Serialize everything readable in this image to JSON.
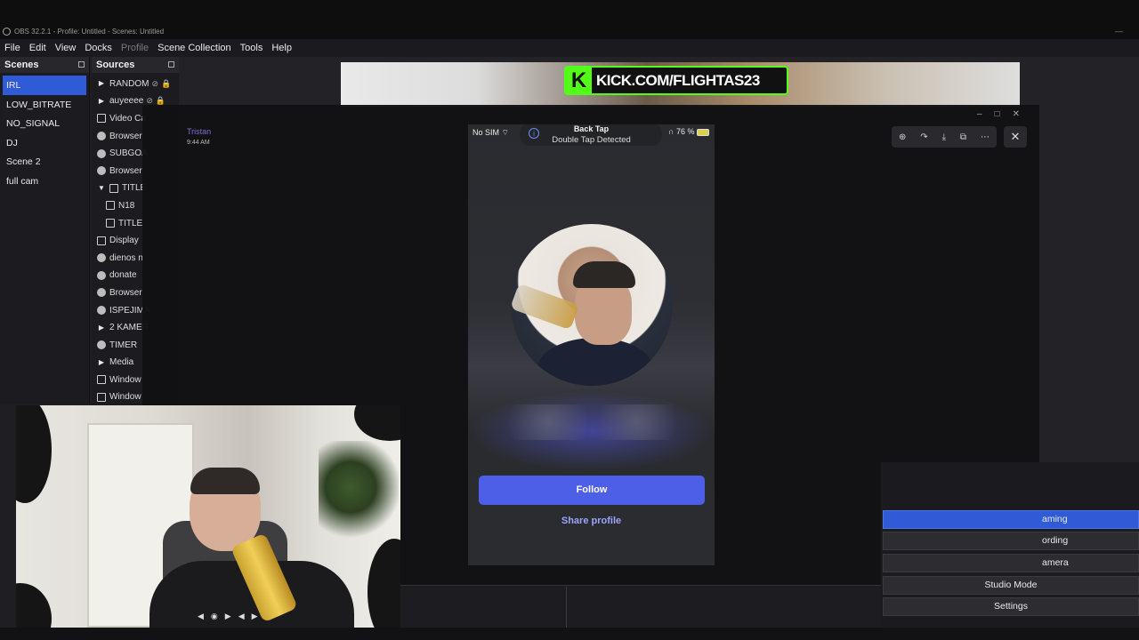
{
  "window": {
    "title": "OBS 32.2.1 - Profile: Untitled - Scenes: Untitled",
    "minimize": "—"
  },
  "menu": [
    "File",
    "Edit",
    "View",
    "Docks",
    "Profile",
    "Scene Collection",
    "Tools",
    "Help"
  ],
  "scenes": {
    "header": "Scenes",
    "items": [
      "IRL",
      "LOW_BITRATE",
      "NO_SIGNAL",
      "DJ",
      "Scene 2",
      "full cam"
    ],
    "active": "IRL"
  },
  "sources": {
    "header": "Sources",
    "items": [
      {
        "label": "RANDOM",
        "icon": "play-icon"
      },
      {
        "label": "auyeeee",
        "icon": "play-icon"
      },
      {
        "label": "Video Ca",
        "icon": "video-capture-icon"
      },
      {
        "label": "Browser",
        "icon": "browser-icon"
      },
      {
        "label": "SUBGOA",
        "icon": "browser-icon"
      },
      {
        "label": "Browser",
        "icon": "browser-icon"
      },
      {
        "label": "TITLE",
        "icon": "folder-icon"
      },
      {
        "label": "N18",
        "icon": "image-icon"
      },
      {
        "label": "TITLE",
        "icon": "image-icon"
      },
      {
        "label": "Display",
        "icon": "display-icon"
      },
      {
        "label": "dienos n",
        "icon": "browser-icon"
      },
      {
        "label": "donate",
        "icon": "browser-icon"
      },
      {
        "label": "Browser",
        "icon": "browser-icon"
      },
      {
        "label": "ISPEJIMA",
        "icon": "browser-icon"
      },
      {
        "label": "2 KAMER",
        "icon": "play-icon"
      },
      {
        "label": "TIMER",
        "icon": "browser-icon"
      },
      {
        "label": "Media",
        "icon": "play-icon"
      },
      {
        "label": "Window",
        "icon": "window-icon"
      },
      {
        "label": "Window",
        "icon": "window-icon"
      }
    ]
  },
  "overlay": {
    "kick_letter": "K",
    "kick_text": "KICK.COM/FLIGHTAS23",
    "chat_name": "Tristan",
    "chat_time": "9:44 AM"
  },
  "phone": {
    "carrier": "No SIM",
    "battery": "76 %",
    "notif_title": "Back Tap",
    "notif_sub": "Double Tap Detected",
    "follow_label": "Follow",
    "share_label": "Share profile"
  },
  "viewer_toolbar": {
    "icons": [
      "zoom-in-icon",
      "rotate-icon",
      "download-icon",
      "open-external-icon",
      "more-icon"
    ],
    "close": "✕"
  },
  "controls": {
    "buttons": [
      {
        "label": "aming",
        "state": "active"
      },
      {
        "label": "ording",
        "state": "normal"
      },
      {
        "label": "amera",
        "state": "normal"
      },
      {
        "label": "Studio Mode",
        "state": "normal"
      },
      {
        "label": "Settings",
        "state": "normal"
      }
    ]
  },
  "colors": {
    "accent": "#2f5bd7",
    "kick_green": "#53fc18",
    "follow_button": "#4e5fe7"
  }
}
